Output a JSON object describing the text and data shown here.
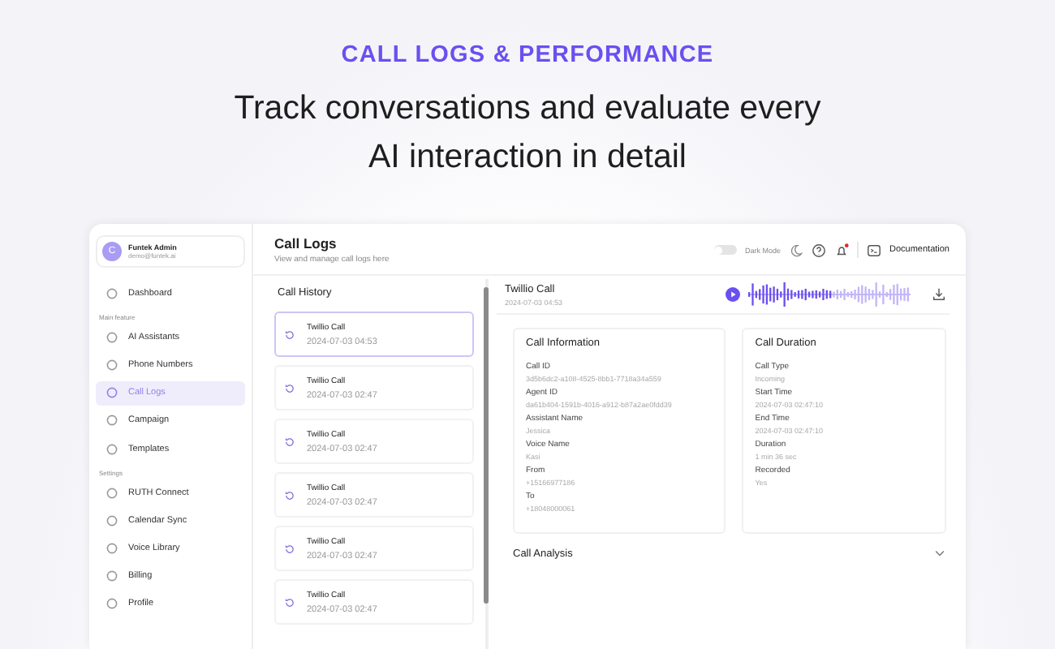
{
  "eyebrow": "CALL LOGS & PERFORMANCE",
  "headline": "Track conversations and evaluate every AI interaction in detail",
  "sidebar": {
    "user": {
      "initial": "C",
      "name": "Funtek Admin",
      "email": "demo@funtek.ai"
    },
    "sections": [
      {
        "items": [
          {
            "label": "Dashboard",
            "selected": false
          }
        ]
      },
      {
        "label": "Main feature",
        "items": [
          {
            "label": "AI Assistants",
            "selected": false
          },
          {
            "label": "Phone Numbers",
            "selected": false
          },
          {
            "label": "Call Logs",
            "selected": true
          },
          {
            "label": "Campaign",
            "selected": false
          },
          {
            "label": "Templates",
            "selected": false
          }
        ]
      },
      {
        "label": "Settings",
        "items": [
          {
            "label": "RUTH Connect",
            "selected": false
          },
          {
            "label": "Calendar Sync",
            "selected": false
          },
          {
            "label": "Voice Library",
            "selected": false
          },
          {
            "label": "Billing",
            "selected": false
          },
          {
            "label": "Profile",
            "selected": false
          }
        ]
      }
    ]
  },
  "page": {
    "title": "Call Logs",
    "subtitle": "View and manage call logs here"
  },
  "toolbar": {
    "dark_mode": {
      "label": "Dark Mode",
      "on": false
    },
    "notification_unread": true,
    "documentation": "Documentation"
  },
  "history": {
    "title": "Call History",
    "items": [
      {
        "name": "Twillio Call",
        "time": "2024-07-03 04:53",
        "selected": true
      },
      {
        "name": "Twillio Call",
        "time": "2024-07-03 02:47",
        "selected": false
      },
      {
        "name": "Twillio Call",
        "time": "2024-07-03 02:47",
        "selected": false
      },
      {
        "name": "Twillio Call",
        "time": "2024-07-03 02:47",
        "selected": false
      },
      {
        "name": "Twillio Call",
        "time": "2024-07-03 02:47",
        "selected": false
      },
      {
        "name": "Twillio Call",
        "time": "2024-07-03 02:47",
        "selected": false
      }
    ]
  },
  "detail": {
    "title": "Twillio Call",
    "time": "2024-07-03 04:53",
    "info": {
      "title": "Call Information",
      "fields": [
        {
          "label": "Call ID",
          "value": "3d5b6dc2-a108-4525-8bb1-7718a34a559"
        },
        {
          "label": "Agent ID",
          "value": "da61b404-1591b-4016-a912-b87a2ae0fdd39"
        },
        {
          "label": "Assistant Name",
          "value": "Jessica"
        },
        {
          "label": "Voice Name",
          "value": "Kasi"
        },
        {
          "label": "From",
          "value": "+15166977186"
        },
        {
          "label": "To",
          "value": "+18048000061"
        }
      ]
    },
    "duration": {
      "title": "Call Duration",
      "fields": [
        {
          "label": "Call Type",
          "value": "Incoming"
        },
        {
          "label": "Start Time",
          "value": "2024-07-03 02:47:10"
        },
        {
          "label": "End Time",
          "value": "2024-07-03 02:47:10"
        },
        {
          "label": "Duration",
          "value": "1 min 36 sec"
        },
        {
          "label": "Recorded",
          "value": "Yes"
        }
      ]
    },
    "analysis": {
      "title": "Call Analysis",
      "expanded": false
    }
  }
}
